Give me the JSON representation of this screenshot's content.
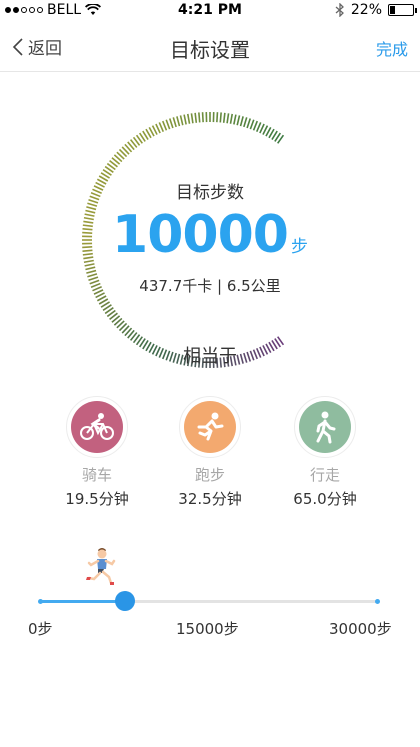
{
  "status_bar": {
    "carrier": "BELL",
    "signal_bars": 2,
    "time": "4:21 PM",
    "battery": "22%",
    "battery_level": 0.22
  },
  "nav": {
    "back_label": "返回",
    "title": "目标设置",
    "done_label": "完成"
  },
  "goal": {
    "label": "目标步数",
    "steps": "10000",
    "unit": "步",
    "summary": "437.7千卡 | 6.5公里"
  },
  "equivalent": {
    "title": "相当于",
    "activities": [
      {
        "icon": "cycling-icon",
        "name": "骑车",
        "time": "19.5分钟",
        "color": "#c2617f"
      },
      {
        "icon": "running-icon",
        "name": "跑步",
        "time": "32.5分钟",
        "color": "#f3a96f"
      },
      {
        "icon": "walking-icon",
        "name": "行走",
        "time": "65.0分钟",
        "color": "#8fbc9f"
      }
    ]
  },
  "slider": {
    "min_label": "0步",
    "mid_label": "15000步",
    "max_label": "30000步",
    "min": 0,
    "max": 30000,
    "value": 7500
  },
  "colors": {
    "accent": "#2ba3ef",
    "gauge_gradient": [
      "#6a3d7a",
      "#3e6b4a",
      "#9a9a3a",
      "#8d9a3a",
      "#3e7a42"
    ]
  }
}
